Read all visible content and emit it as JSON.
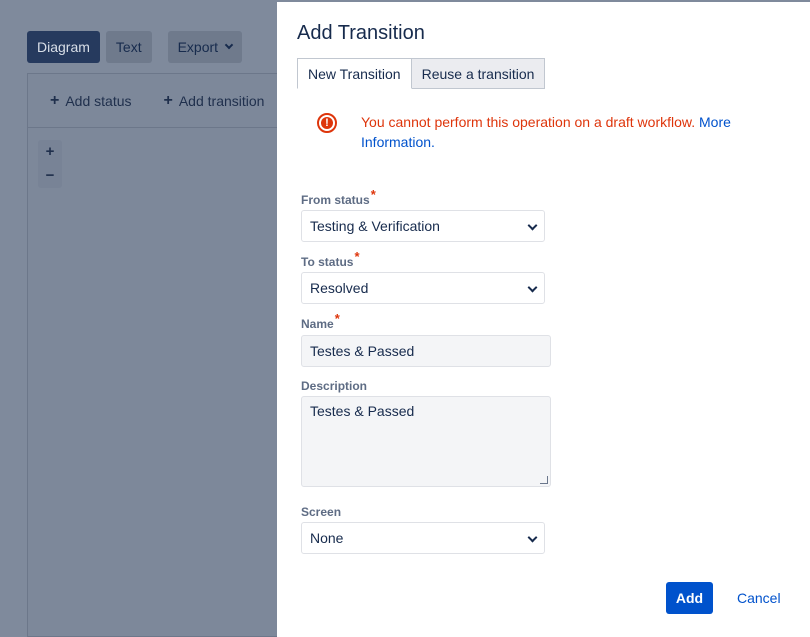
{
  "background": {
    "toolbar": {
      "diagram": "Diagram",
      "text": "Text",
      "export": "Export"
    },
    "panel": {
      "add_status": "Add status",
      "add_transition": "Add transition"
    },
    "zoom": {
      "in": "+",
      "out": "−"
    }
  },
  "dialog": {
    "title": "Add Transition",
    "tabs": [
      "New Transition",
      "Reuse a transition"
    ],
    "error": {
      "message": "You cannot perform this operation on a draft workflow.",
      "link": "More Information."
    },
    "fields": {
      "from_status": {
        "label": "From status",
        "value": "Testing & Verification"
      },
      "to_status": {
        "label": "To status",
        "value": "Resolved"
      },
      "name": {
        "label": "Name",
        "value": "Testes & Passed"
      },
      "description": {
        "label": "Description",
        "value": "Testes & Passed"
      },
      "screen": {
        "label": "Screen",
        "value": "None"
      }
    },
    "required_mark": "*",
    "add_label": "Add",
    "cancel_label": "Cancel"
  }
}
